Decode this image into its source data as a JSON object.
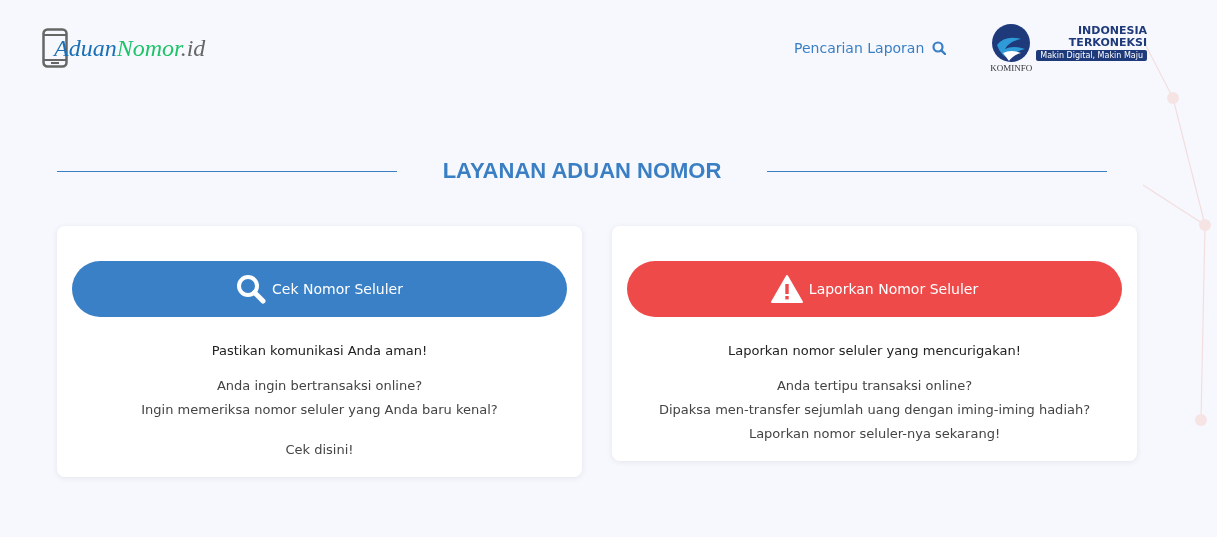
{
  "header": {
    "logo": [
      "Aduan",
      "Nomor",
      ".id"
    ],
    "search_link": "Pencarian Laporan",
    "partner": {
      "kominfo": "KOMINFO",
      "lines": [
        "INDONESIA",
        "TERKONEKSI"
      ],
      "tagline": "Makin Digital, Makin Maju"
    }
  },
  "section_title": "LAYANAN ADUAN NOMOR",
  "cards": [
    {
      "kind": "check",
      "button": "Cek Nomor Seluler",
      "lead": "Pastikan komunikasi Anda aman!",
      "paragraphs": [
        [
          "Anda ingin bertransaksi online?",
          "Ingin memeriksa nomor seluler yang Anda baru kenal?"
        ],
        [
          "Cek disini!"
        ]
      ]
    },
    {
      "kind": "report",
      "button": "Laporkan Nomor Seluler",
      "lead": "Laporkan nomor seluler yang mencurigakan!",
      "paragraphs": [
        [
          "Anda tertipu transaksi online?",
          "Dipaksa men-transfer sejumlah uang dengan iming-iming hadiah?",
          "Laporkan nomor seluler-nya sekarang!"
        ]
      ]
    }
  ]
}
